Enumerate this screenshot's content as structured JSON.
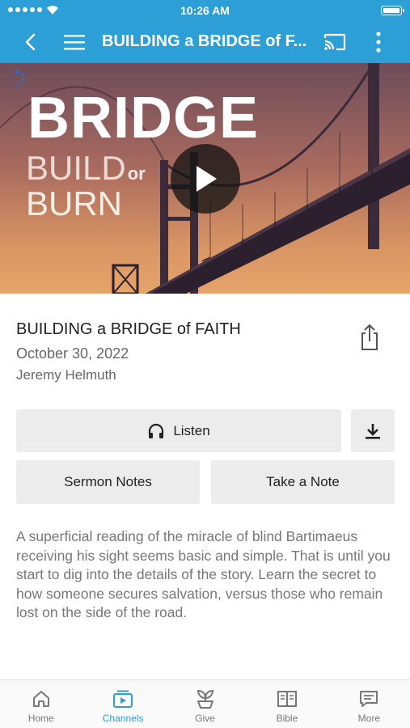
{
  "status_bar": {
    "time": "10:26 AM"
  },
  "toolbar": {
    "title": "BUILDING a BRIDGE of F...",
    "back_icon": "chevron-left-icon",
    "menu_icon": "hamburger-menu-icon",
    "cast_icon": "cast-icon",
    "more_icon": "more-vertical-icon"
  },
  "hero": {
    "line1": "BRIDGE",
    "line2": "BUILD",
    "line2_or": "or",
    "line3": "BURN",
    "play_icon": "play-icon"
  },
  "sermon": {
    "title": "BUILDING a BRIDGE of FAITH",
    "date": "October 30, 2022",
    "speaker": "Jeremy Helmuth",
    "description": "A superficial reading of the miracle of blind Bartimaeus receiving his sight seems basic and simple. That is until you start to dig into the details of the story. Learn the secret to how someone secures salvation, versus those who remain lost on the side of the road."
  },
  "actions": {
    "listen_label": "Listen",
    "sermon_notes_label": "Sermon Notes",
    "take_note_label": "Take a Note"
  },
  "tabs": [
    {
      "label": "Home",
      "icon": "home-icon"
    },
    {
      "label": "Channels",
      "icon": "channels-icon",
      "active": true
    },
    {
      "label": "Give",
      "icon": "give-icon"
    },
    {
      "label": "Bible",
      "icon": "bible-icon"
    },
    {
      "label": "More",
      "icon": "more-icon"
    }
  ],
  "colors": {
    "brand": "#2b9fd6",
    "button_bg": "#ececec"
  }
}
